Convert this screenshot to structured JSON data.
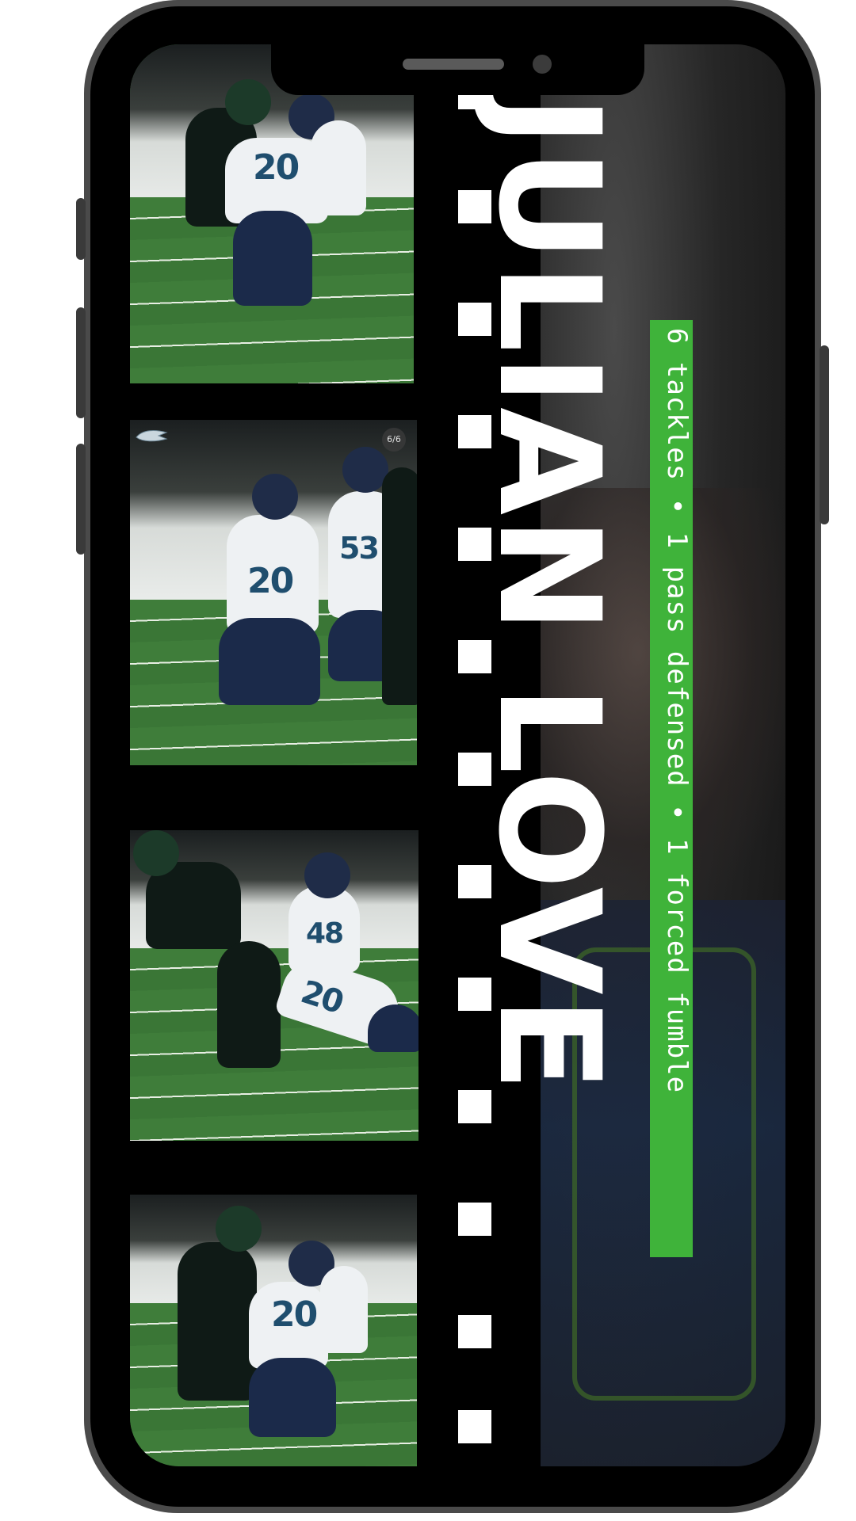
{
  "hero": {
    "player_name": "JULIAN LOVE",
    "stats_line": "6 tackles • 1 pass defensed • 1 forced fumble"
  },
  "gallery": {
    "photo_count_badge": "6/6"
  },
  "photos": [
    {
      "jersey_number": "20"
    },
    {
      "jersey_number": "20",
      "teammate_number": "53"
    },
    {
      "jersey_number": "20",
      "teammate_number": "48"
    },
    {
      "jersey_number": "20"
    }
  ],
  "colors": {
    "accent_green": "#3fb33a",
    "seahawks_navy": "#1b2a4a",
    "seahawks_blue": "#1f4e6e"
  },
  "icons": {
    "team_logo": "seahawks-logo-icon"
  }
}
